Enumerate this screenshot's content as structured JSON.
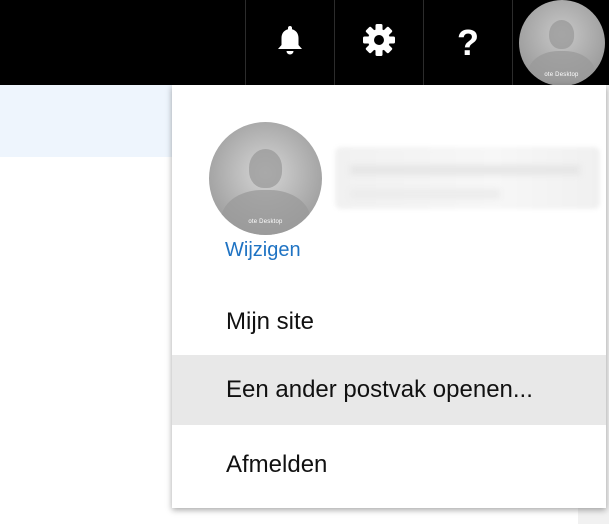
{
  "topbar": {
    "icons": [
      "bell-icon",
      "gear-icon",
      "help-icon",
      "avatar"
    ],
    "help_glyph": "?",
    "avatar_caption": "ote Desktop"
  },
  "profile": {
    "photo_caption": "ote Desktop",
    "change_label": "Wijzigen"
  },
  "menu": {
    "items": [
      {
        "label": "Mijn site"
      },
      {
        "label": "Een ander postvak openen..."
      },
      {
        "label": "Afmelden"
      }
    ]
  },
  "colors": {
    "topbar_bg": "#000000",
    "link": "#1f73c3",
    "hover_bg": "#e8e8e8",
    "left_band": "#eef5fd"
  }
}
